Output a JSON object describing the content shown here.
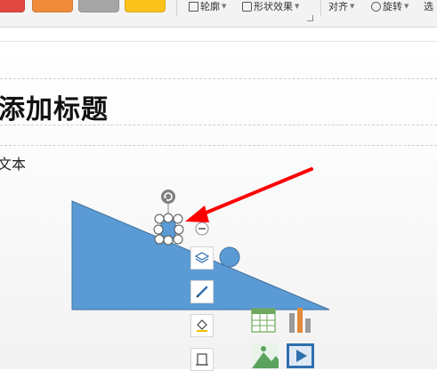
{
  "ribbon": {
    "swatches": [
      {
        "name": "style-swatch-red",
        "color": "#e0473f"
      },
      {
        "name": "style-swatch-orange",
        "color": "#ee8a3a"
      },
      {
        "name": "style-swatch-gray",
        "color": "#a5a5a5"
      },
      {
        "name": "style-swatch-yellow",
        "color": "#fbc21c"
      }
    ],
    "outline_label": "轮廓",
    "shape_effects_label": "形状效果",
    "align_label": "对齐",
    "rotate_label": "旋转",
    "select_label": "选"
  },
  "slide": {
    "title_placeholder": "添加标题",
    "body_placeholder": "文本"
  },
  "colors": {
    "shape_fill": "#5b9bd5",
    "shape_stroke": "#41719c",
    "arrow": "#ff0000"
  },
  "icons": {
    "layers": "layers-icon",
    "pen": "pen-icon",
    "fill": "fill-icon",
    "frame": "frame-icon",
    "table": "table-icon",
    "chart": "chart-icon",
    "picture": "picture-icon",
    "video": "video-icon"
  }
}
